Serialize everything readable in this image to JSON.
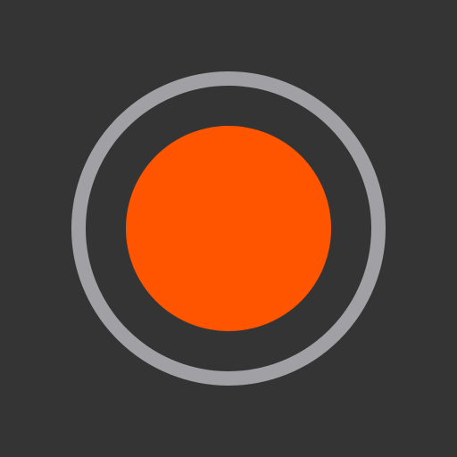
{
  "app": {
    "icon_name": "record-icon",
    "control": "record-button"
  },
  "colors": {
    "background": "#343434",
    "ring": "#a1a1a5",
    "record_dot": "#ff5500"
  }
}
